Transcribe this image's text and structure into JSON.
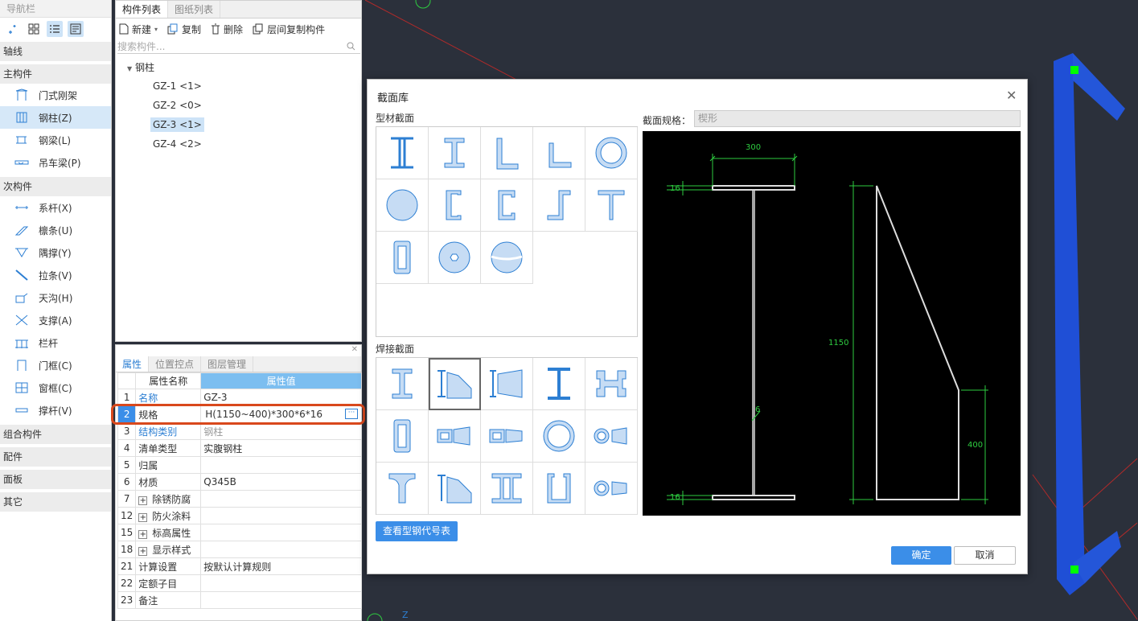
{
  "nav": {
    "title": "导航栏",
    "cat_axis": "轴线",
    "cat_main": "主构件",
    "main_items": [
      "门式刚架",
      "钢柱(Z)",
      "钢梁(L)",
      "吊车梁(P)"
    ],
    "cat_sub": "次构件",
    "sub_items": [
      "系杆(X)",
      "檩条(U)",
      "隅撑(Y)",
      "拉条(V)",
      "天沟(H)",
      "支撑(A)",
      "栏杆",
      "门框(C)",
      "窗框(C)",
      "撑杆(V)"
    ],
    "cat_combo": "组合构件",
    "cat_parts": "配件",
    "cat_panel": "面板",
    "cat_other": "其它"
  },
  "clist": {
    "tab1": "构件列表",
    "tab2": "图纸列表",
    "new": "新建",
    "copy": "复制",
    "delete": "删除",
    "floor_copy": "层间复制构件",
    "search_placeholder": "搜索构件...",
    "root": "钢柱",
    "items": [
      "GZ-1 <1>",
      "GZ-2 <0>",
      "GZ-3 <1>",
      "GZ-4 <2>"
    ]
  },
  "props": {
    "tab1": "属性",
    "tab2": "位置控点",
    "tab3": "图层管理",
    "h_name": "属性名称",
    "h_value": "属性值",
    "rows": [
      {
        "n": "1",
        "k": "名称",
        "v": "GZ-3"
      },
      {
        "n": "2",
        "k": "规格",
        "v": "H(1150~400)*300*6*16"
      },
      {
        "n": "3",
        "k": "结构类别",
        "v": "钢柱"
      },
      {
        "n": "4",
        "k": "清单类型",
        "v": "实腹钢柱"
      },
      {
        "n": "5",
        "k": "归属",
        "v": ""
      },
      {
        "n": "6",
        "k": "材质",
        "v": "Q345B"
      },
      {
        "n": "7",
        "k": "除锈防腐",
        "v": ""
      },
      {
        "n": "12",
        "k": "防火涂料",
        "v": ""
      },
      {
        "n": "15",
        "k": "标高属性",
        "v": ""
      },
      {
        "n": "18",
        "k": "显示样式",
        "v": ""
      },
      {
        "n": "21",
        "k": "计算设置",
        "v": "按默认计算规则"
      },
      {
        "n": "22",
        "k": "定额子目",
        "v": ""
      },
      {
        "n": "23",
        "k": "备注",
        "v": ""
      }
    ]
  },
  "modal": {
    "title": "截面库",
    "section1": "型材截面",
    "section2": "焊接截面",
    "spec_label": "截面规格：",
    "spec_value": "楔形",
    "view_table": "查看型钢代号表",
    "ok": "确定",
    "cancel": "取消",
    "dims": {
      "w": "300",
      "tf_top": "16",
      "tw": "6",
      "h": "1150",
      "h2": "400",
      "tf_bot": "16"
    }
  },
  "canvas": {
    "axis_a": "Z"
  },
  "colors": {
    "accent": "#3b8ee8",
    "red_outline": "#d9481c",
    "column_blue": "#1f4fd6",
    "dim_green": "#2ecc40"
  }
}
